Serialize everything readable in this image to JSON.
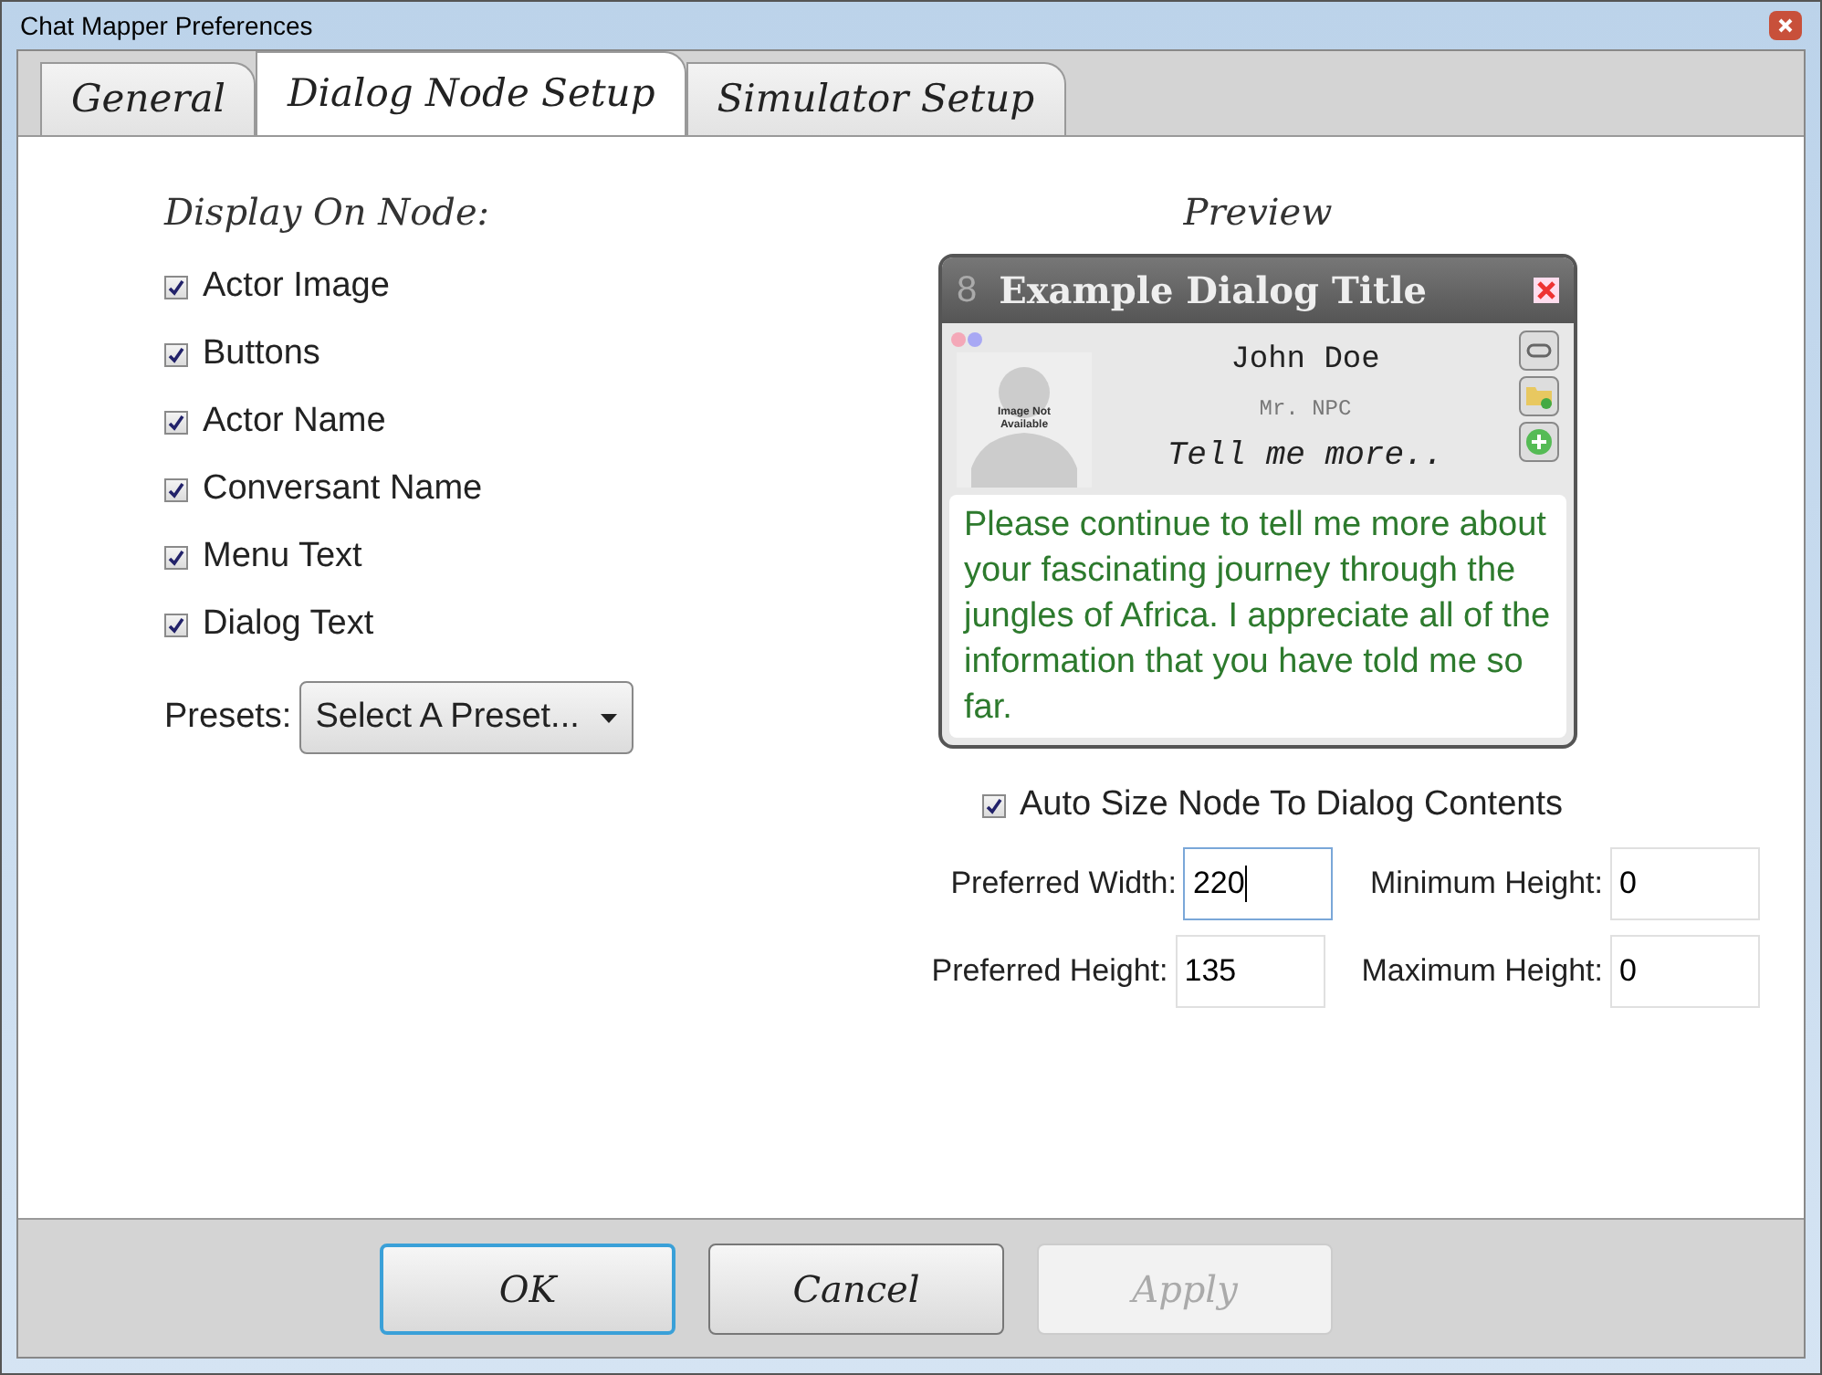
{
  "window": {
    "title": "Chat Mapper Preferences"
  },
  "tabs": [
    {
      "label": "General",
      "selected": false
    },
    {
      "label": "Dialog Node Setup",
      "selected": true
    },
    {
      "label": "Simulator Setup",
      "selected": false
    }
  ],
  "display": {
    "heading": "Display On Node:",
    "options": [
      {
        "label": "Actor Image",
        "checked": true
      },
      {
        "label": "Buttons",
        "checked": true
      },
      {
        "label": "Actor Name",
        "checked": true
      },
      {
        "label": "Conversant Name",
        "checked": true
      },
      {
        "label": "Menu Text",
        "checked": true
      },
      {
        "label": "Dialog Text",
        "checked": true
      }
    ],
    "presets_label": "Presets:",
    "presets_value": "Select A Preset..."
  },
  "preview": {
    "heading": "Preview",
    "number": "8",
    "title": "Example Dialog Title",
    "image_text": "Image Not Available",
    "actor": "John Doe",
    "conversant": "Mr. NPC",
    "menu_text": "Tell me more..",
    "dialog_text": "Please continue to tell me more about your fascinating journey through the jungles of Africa.  I appreciate all of the information that you have told me so far."
  },
  "auto_size": {
    "label": "Auto Size Node To Dialog Contents",
    "checked": true
  },
  "fields": [
    {
      "label": "Preferred Width:",
      "value": "220",
      "focused": true
    },
    {
      "label": "Minimum Height:",
      "value": "0",
      "focused": false
    },
    {
      "label": "Preferred Height:",
      "value": "135",
      "focused": false
    },
    {
      "label": "Maximum Height:",
      "value": "0",
      "focused": false
    }
  ],
  "buttons": [
    {
      "label": "OK",
      "kind": "default",
      "disabled": false
    },
    {
      "label": "Cancel",
      "kind": "normal",
      "disabled": false
    },
    {
      "label": "Apply",
      "kind": "normal",
      "disabled": true
    }
  ]
}
